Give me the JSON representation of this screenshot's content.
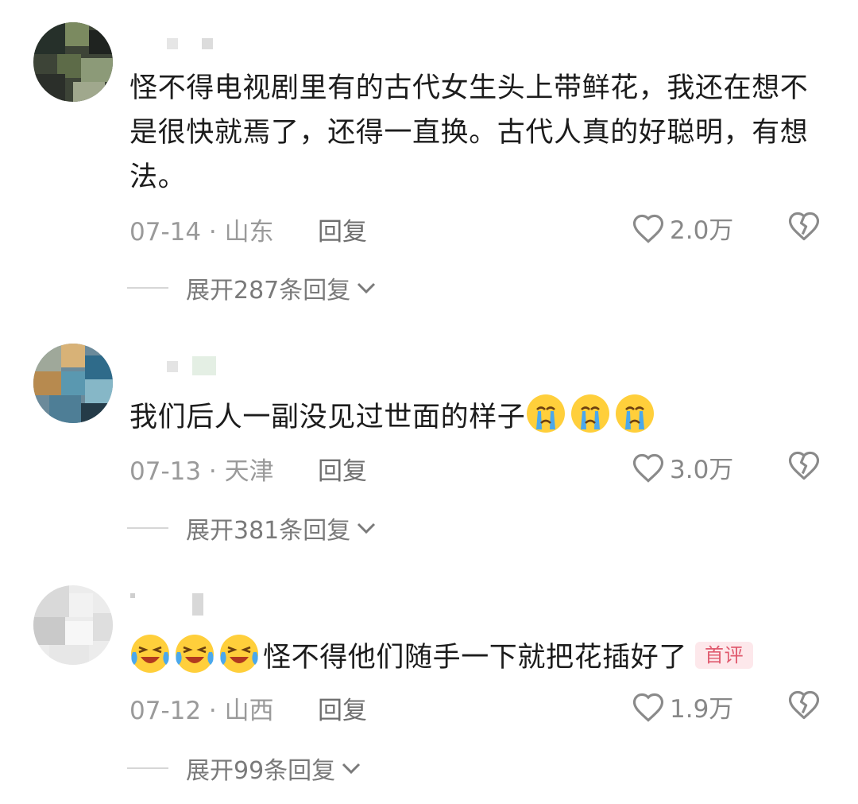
{
  "reply_label": "回复",
  "comments": [
    {
      "text": "怪不得电视剧里有的古代女生头上带鲜花，我还在想不是很快就焉了，还得一直换。古代人真的好聪明，有想法。",
      "date_location": "07-14 · 山东",
      "likes": "2.0万",
      "expand": "展开287条回复"
    },
    {
      "text": "我们后人一副没见过世面的样子",
      "emoji_suffix": [
        "crying-emoji",
        "crying-emoji",
        "crying-emoji"
      ],
      "date_location": "07-13 · 天津",
      "likes": "3.0万",
      "expand": "展开381条回复"
    },
    {
      "text": "怪不得他们随手一下就把花插好了",
      "emoji_prefix": [
        "laugh-cry-emoji",
        "laugh-cry-emoji",
        "laugh-cry-emoji"
      ],
      "badge": "首评",
      "date_location": "07-12 · 山西",
      "likes": "1.9万",
      "expand": "展开99条回复"
    }
  ],
  "colors": {
    "text": "#1c1c1c",
    "meta": "#9a9a9a",
    "badge_text": "#e05a6e",
    "badge_bg": "#fde8eb"
  }
}
